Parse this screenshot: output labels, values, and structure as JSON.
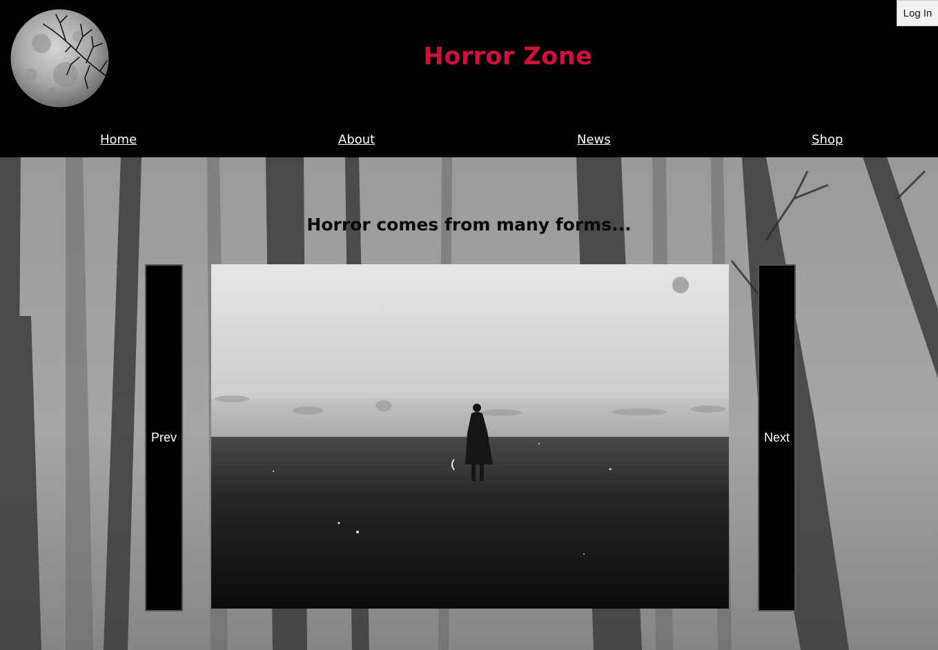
{
  "header": {
    "title": "Horror Zone",
    "login_label": "Log In",
    "title_color": "#d0103c",
    "logo_icon": "full-moon-with-branches-icon"
  },
  "nav": {
    "items": [
      {
        "label": "Home"
      },
      {
        "label": "About"
      },
      {
        "label": "News"
      },
      {
        "label": "Shop"
      }
    ]
  },
  "main": {
    "tagline": "Horror comes from many forms...",
    "carousel": {
      "prev_label": "Prev",
      "next_label": "Next"
    }
  }
}
